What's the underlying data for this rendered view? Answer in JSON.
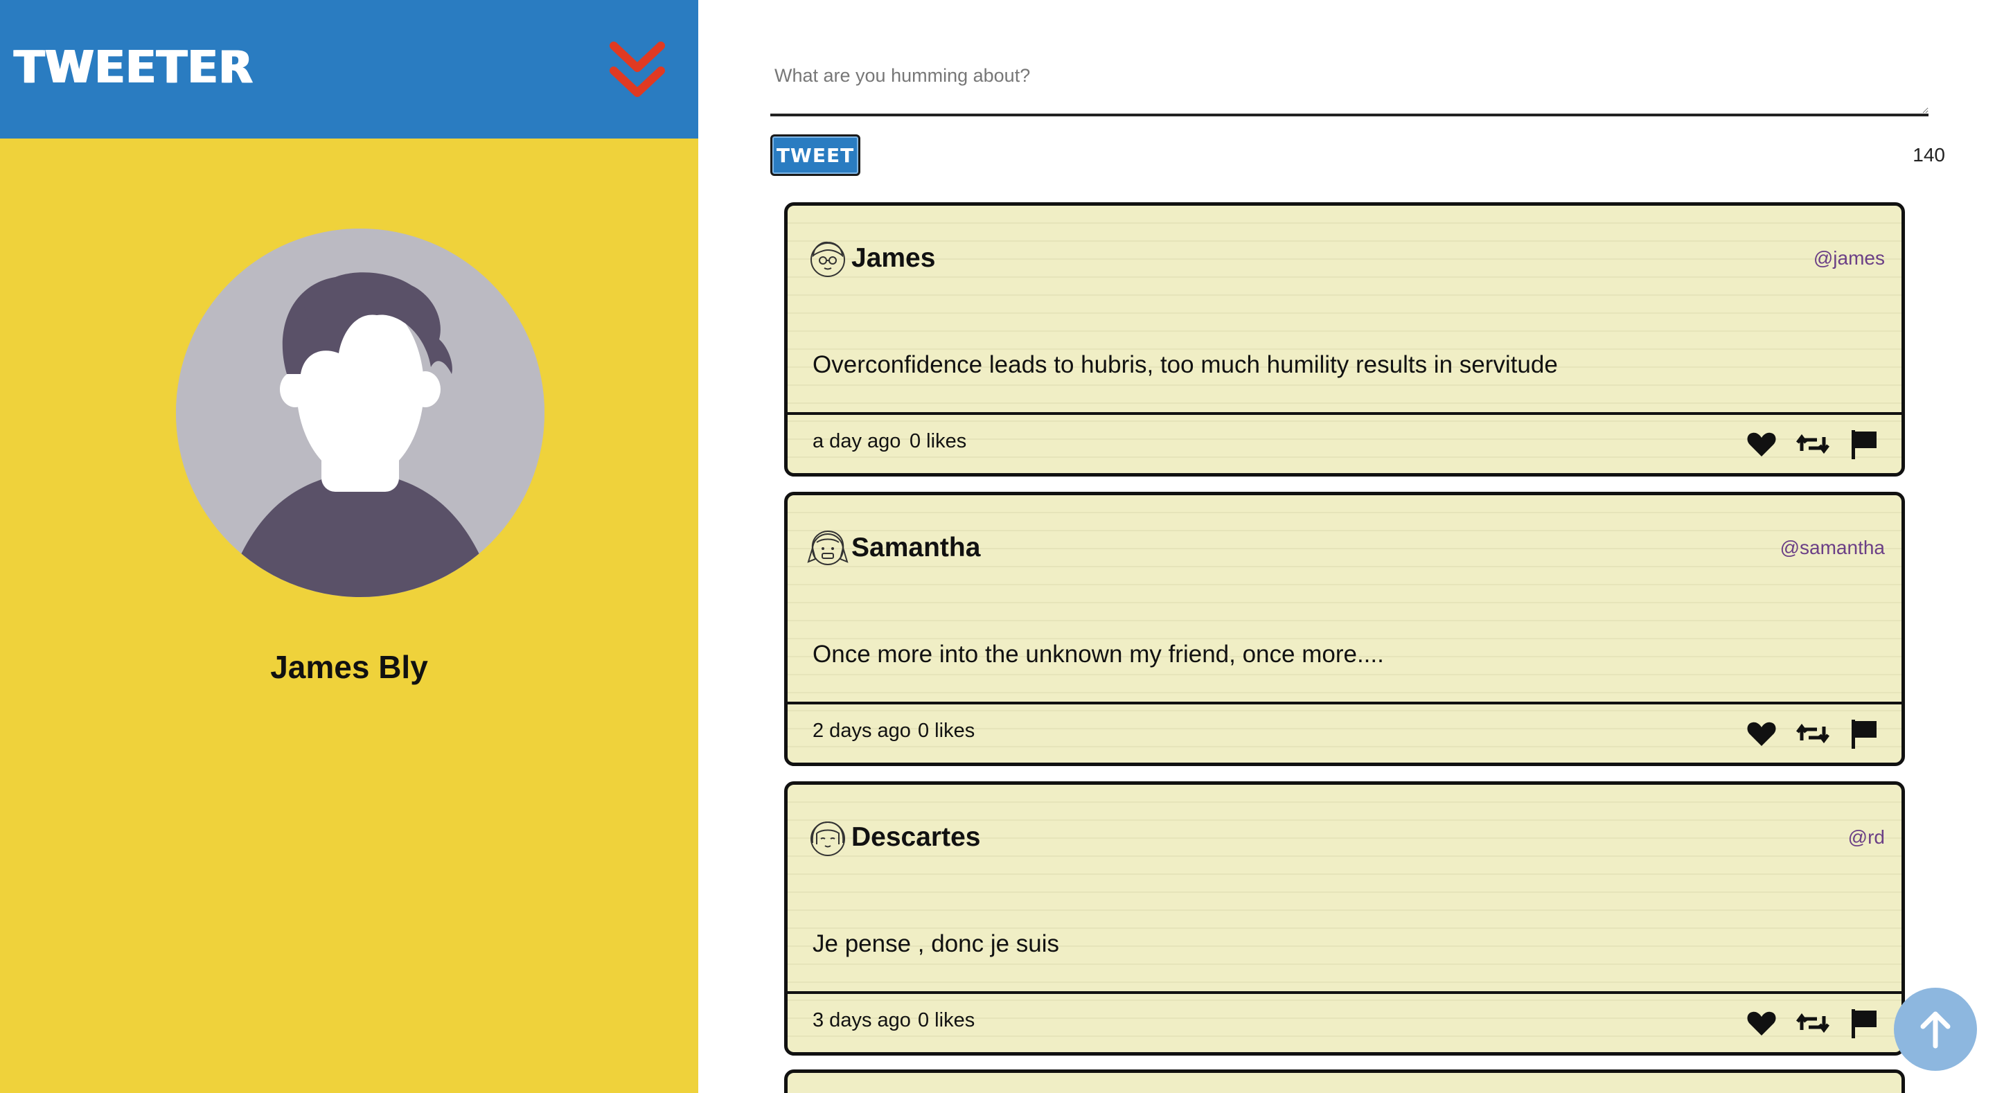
{
  "sidebar": {
    "brand": "TWEETER",
    "profile_name": "James Bly",
    "toggle_icon": "double-chevron-down-icon"
  },
  "compose": {
    "placeholder": "What are you humming about?",
    "value": "",
    "tweet_button_label": "TWEET",
    "char_count": "140"
  },
  "tweets": [
    {
      "name": "James",
      "handle": "@james",
      "text": "Overconfidence leads to hubris, too much humility results in servitude",
      "date": "a day ago",
      "likes": "0 likes",
      "avatar_icon": "glasses-boy-avatar-icon"
    },
    {
      "name": "Samantha",
      "handle": "@samantha",
      "text": "Once more into the unknown my friend, once more....",
      "date": "2 days ago",
      "likes": "0 likes",
      "avatar_icon": "pigtails-girl-avatar-icon"
    },
    {
      "name": "Descartes",
      "handle": "@rd",
      "text": "Je pense , donc je suis",
      "date": "3 days ago",
      "likes": "0 likes",
      "avatar_icon": "bob-hair-avatar-icon"
    }
  ],
  "actions": {
    "like_icon": "heart-icon",
    "retweet_icon": "retweet-icon",
    "flag_icon": "flag-icon"
  },
  "scroll_top_icon": "arrow-up-icon",
  "colors": {
    "topbar": "#2a7cc1",
    "sidebar": "#efd23b",
    "toggle": "#e03a22",
    "card": "#f0eec5",
    "handle": "#6b3f86",
    "avatar_bg": "#bbbac2",
    "avatar_fg": "#5a5168",
    "scroll_top": "#8db7df"
  }
}
